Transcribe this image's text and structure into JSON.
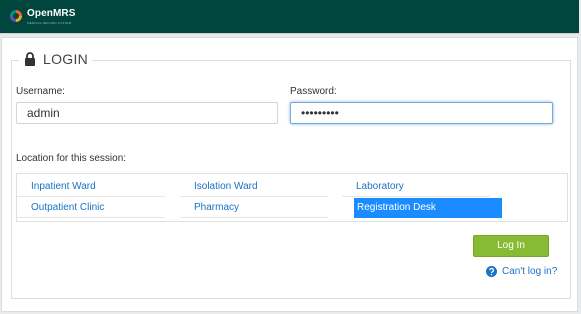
{
  "header": {
    "app_name": "OpenMRS",
    "tagline": "MEDICAL RECORD SYSTEM",
    "colors": {
      "bar": "#00463f"
    }
  },
  "login": {
    "title": "LOGIN",
    "username_label": "Username:",
    "username_value": "admin",
    "password_label": "Password:",
    "password_value": "•••••••••",
    "location_label": "Location for this session:",
    "locations": [
      {
        "label": "Inpatient Ward",
        "selected": false
      },
      {
        "label": "Isolation Ward",
        "selected": false
      },
      {
        "label": "Laboratory",
        "selected": false
      },
      {
        "label": "Outpatient Clinic",
        "selected": false
      },
      {
        "label": "Pharmacy",
        "selected": false
      },
      {
        "label": "Registration Desk",
        "selected": true
      }
    ],
    "login_button": "Log In",
    "cant_login": "Can't log in?",
    "colors": {
      "selected_location": "#1a8cff",
      "button": "#88bb33",
      "link": "#1a73c4"
    },
    "icons": {
      "title": "lock-icon",
      "help": "help-circle-icon"
    }
  }
}
